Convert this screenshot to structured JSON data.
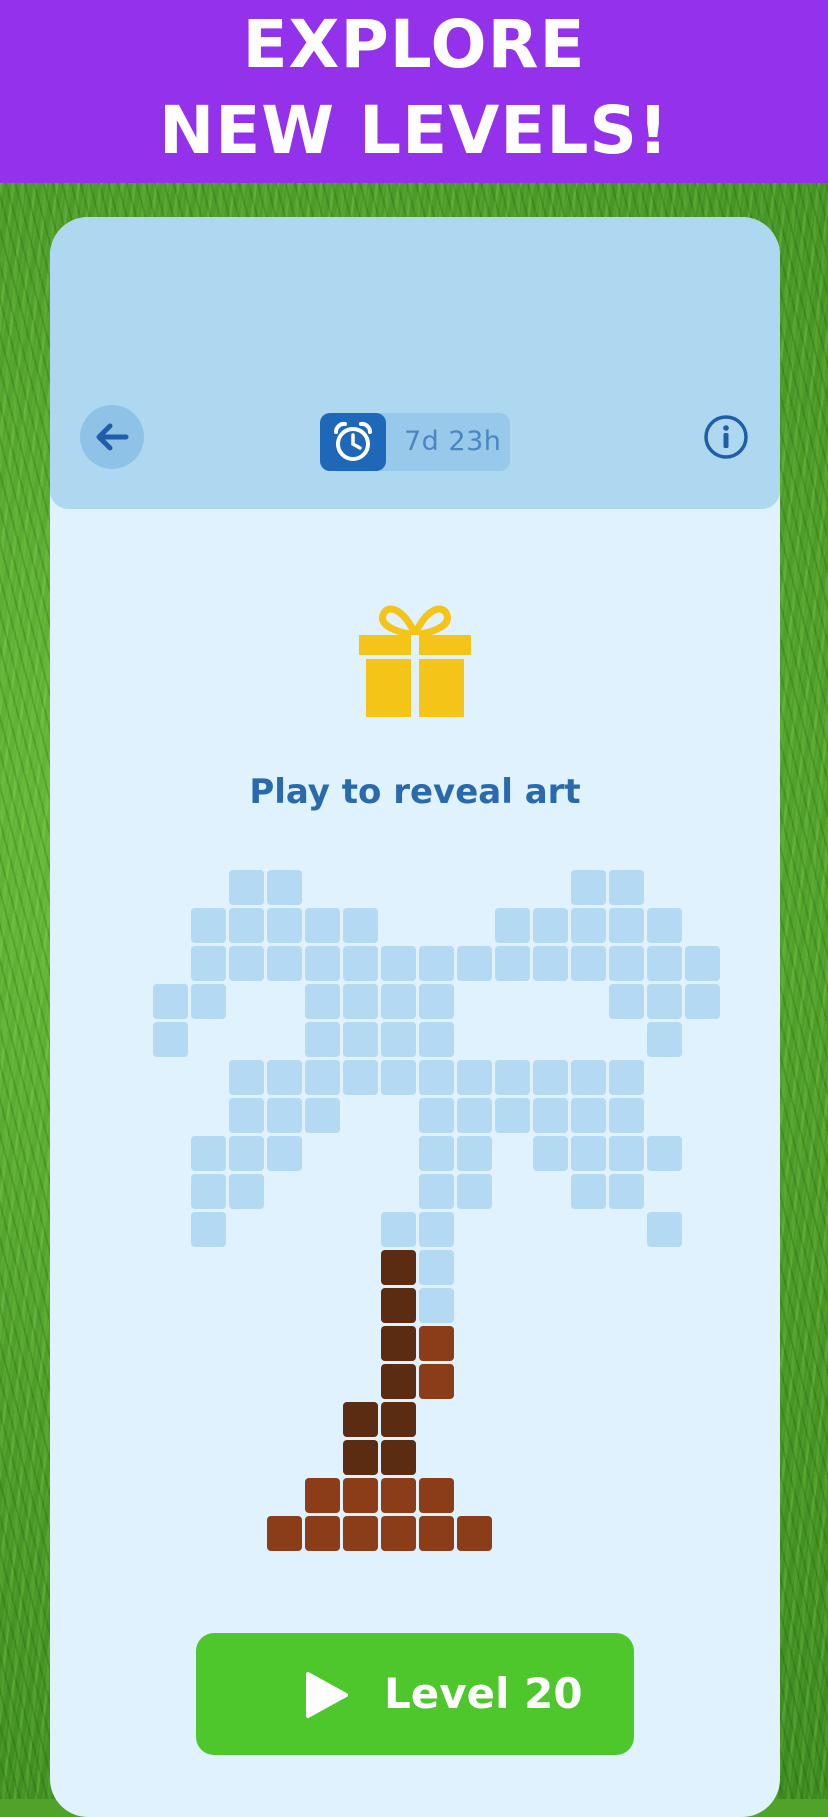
{
  "banner": {
    "line1": "EXPLORE",
    "line2": "NEW LEVELS!"
  },
  "header": {
    "back_icon": "arrow-left-icon",
    "timer_icon": "alarm-clock-icon",
    "timer_text": "7d 23h",
    "info_icon": "info-icon"
  },
  "reward": {
    "icon": "gift-icon",
    "prompt": "Play to reveal art"
  },
  "pixel_art": {
    "subject": "palm tree (partially revealed)",
    "colors": {
      "hidden": "#b3daf2",
      "trunk_dark": "#5b2b12",
      "trunk_brown": "#8a3d16"
    }
  },
  "play_button": {
    "icon": "play-icon",
    "label": "Level 20"
  },
  "colors": {
    "banner": "#9332ea",
    "card": "#dff2fd",
    "header": "#aed8f0",
    "accent": "#1f68b8",
    "button": "#4ec72d",
    "gift": "#f5c419"
  }
}
